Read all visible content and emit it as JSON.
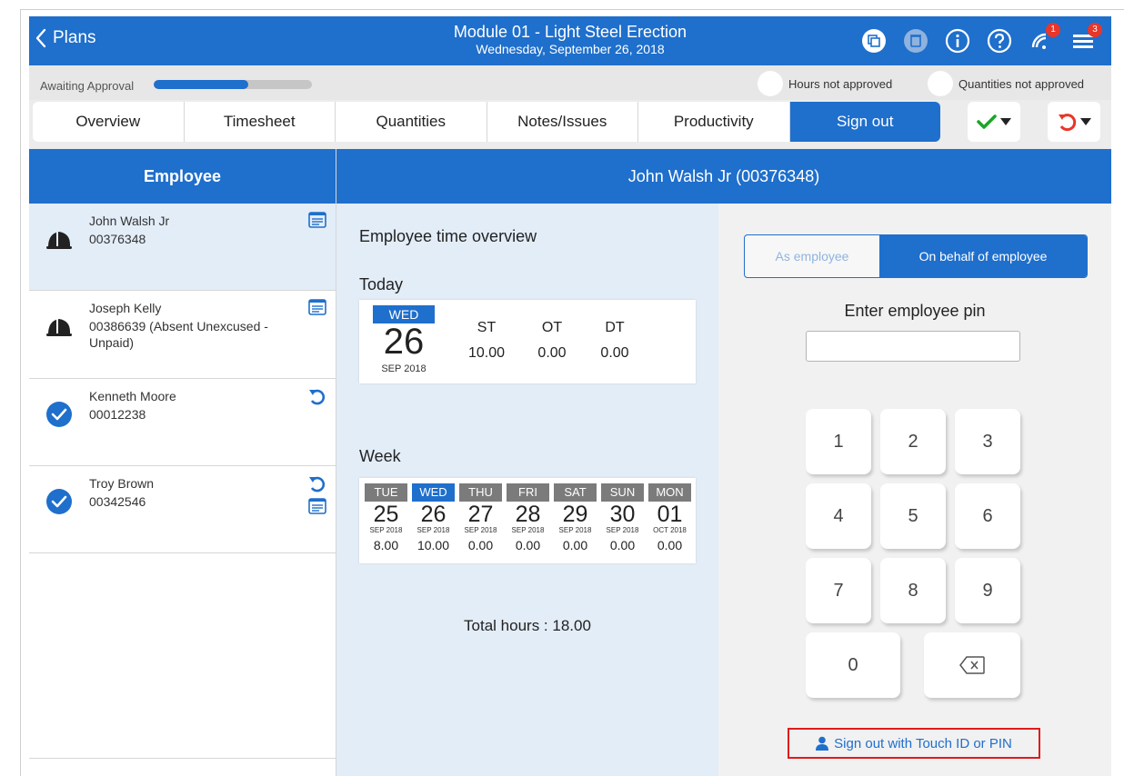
{
  "header": {
    "back_label": "Plans",
    "title": "Module 01 - Light Steel Erection",
    "subtitle": "Wednesday, September 26, 2018",
    "icons": [
      "copy-icon",
      "delete-icon",
      "info-icon",
      "help-icon",
      "signal-icon",
      "menu-icon"
    ],
    "signal_badge": "1",
    "menu_badge": "3"
  },
  "status": {
    "label": "Awaiting Approval",
    "progress": 0.6,
    "hours_legend": "Hours not approved",
    "quantities_legend": "Quantities not approved"
  },
  "tabs": [
    {
      "label": "Overview"
    },
    {
      "label": "Timesheet"
    },
    {
      "label": "Quantities"
    },
    {
      "label": "Notes/Issues"
    },
    {
      "label": "Productivity"
    },
    {
      "label": "Sign out",
      "active": true
    }
  ],
  "actions": {
    "approve_icon": "checkmark-icon",
    "undo_icon": "undo-icon"
  },
  "colors": {
    "primary": "#1f6fcc",
    "selected_bg": "#e3edf8",
    "success": "#1aa528",
    "danger": "#e8362a"
  },
  "employee_list": {
    "header": "Employee",
    "items": [
      {
        "name": "John Walsh Jr",
        "id": "00376348",
        "icon": "hardhat-icon",
        "action_icons": [
          "notes-icon"
        ]
      },
      {
        "name": "Joseph Kelly",
        "id": "00386639 (Absent Unexcused - Unpaid)",
        "icon": "hardhat-icon",
        "action_icons": [
          "notes-icon"
        ]
      },
      {
        "name": "Kenneth Moore",
        "id": "00012238",
        "icon": "check-circle-icon",
        "action_icons": [
          "undo-icon"
        ]
      },
      {
        "name": "Troy Brown",
        "id": "00342546",
        "icon": "check-circle-icon",
        "action_icons": [
          "undo-icon",
          "notes-icon"
        ]
      }
    ]
  },
  "detail": {
    "header": "John Walsh Jr (00376348)",
    "overview_title": "Employee time overview",
    "today_label": "Today",
    "today": {
      "dow": "WED",
      "day": "26",
      "month": "SEP 2018",
      "st_label": "ST",
      "st": "10.00",
      "ot_label": "OT",
      "ot": "0.00",
      "dt_label": "DT",
      "dt": "0.00"
    },
    "week_label": "Week",
    "week": [
      {
        "dow": "TUE",
        "day": "25",
        "month": "SEP 2018",
        "hours": "8.00"
      },
      {
        "dow": "WED",
        "day": "26",
        "month": "SEP 2018",
        "hours": "10.00",
        "active": true
      },
      {
        "dow": "THU",
        "day": "27",
        "month": "SEP 2018",
        "hours": "0.00"
      },
      {
        "dow": "FRI",
        "day": "28",
        "month": "SEP 2018",
        "hours": "0.00"
      },
      {
        "dow": "SAT",
        "day": "29",
        "month": "SEP 2018",
        "hours": "0.00"
      },
      {
        "dow": "SUN",
        "day": "30",
        "month": "SEP 2018",
        "hours": "0.00"
      },
      {
        "dow": "MON",
        "day": "01",
        "month": "OCT 2018",
        "hours": "0.00"
      }
    ],
    "total_label": "Total hours :",
    "total_value": "18.00"
  },
  "signout": {
    "mode_as_employee": "As employee",
    "mode_on_behalf": "On behalf of employee",
    "pin_label": "Enter employee pin",
    "pin_value": "",
    "keys": [
      "1",
      "2",
      "3",
      "4",
      "5",
      "6",
      "7",
      "8",
      "9",
      "0"
    ],
    "touch_button": "Sign out with Touch ID or PIN"
  }
}
